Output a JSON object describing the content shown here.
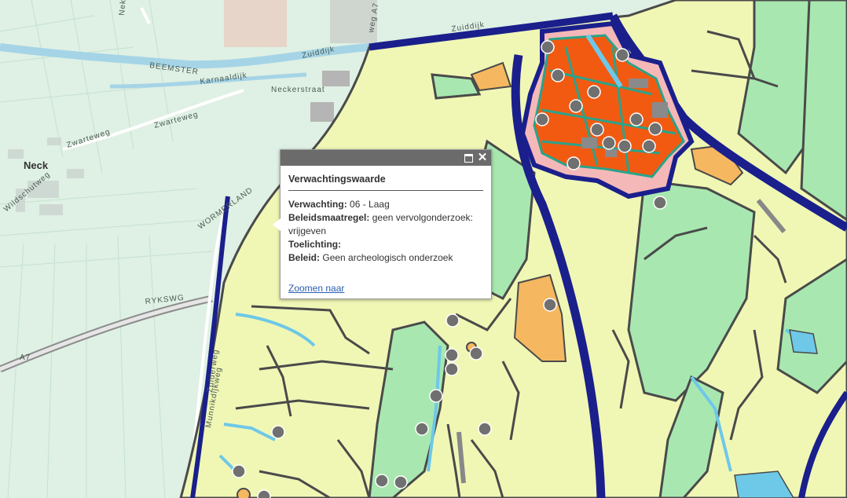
{
  "map": {
    "labels": {
      "beemster": "BEEMSTER",
      "zuiddijk_left": "Zuiddijk",
      "zuiddijk_right": "Zuiddijk",
      "karnaaldijk": "Karnaaldijk",
      "neckerstraat": "Neckerstraat",
      "zwarteweg_1": "Zwarteweg",
      "zwarteweg_2": "Zwarteweg",
      "neck": "Neck",
      "wildschutweg": "Wildschutweg",
      "wormerland": "WORMERLAND",
      "rykswg": "RYKSWG",
      "a7": "A7",
      "zuiderweg": "Zuiderweg",
      "munnikdijkweg": "Munnikdijkweg",
      "weg_a7": "weg A7",
      "nek": "Nek"
    },
    "colors": {
      "base": "#dff0e4",
      "low_expectation": "#f0f7b5",
      "medium_green": "#a8e8b0",
      "high_orange": "#f5b860",
      "town_red": "#f25a12",
      "town_pink": "#f5b8b8",
      "water_dark": "#1a1f8c",
      "water_light": "#6ec8e8",
      "outline": "#4a4a4a"
    }
  },
  "popup": {
    "title": "Verwachtingswaarde",
    "fields": [
      {
        "label": "Verwachting:",
        "value": "06 - Laag"
      },
      {
        "label": "Beleidsmaatregel:",
        "value": "geen vervolgonderzoek: vrijgeven"
      },
      {
        "label": "Toelichting:",
        "value": ""
      },
      {
        "label": "Beleid:",
        "value": "Geen archeologisch onderzoek"
      }
    ],
    "zoom_link": "Zoomen naar",
    "maximize_icon": "maximize-icon",
    "close_icon": "close-icon"
  }
}
